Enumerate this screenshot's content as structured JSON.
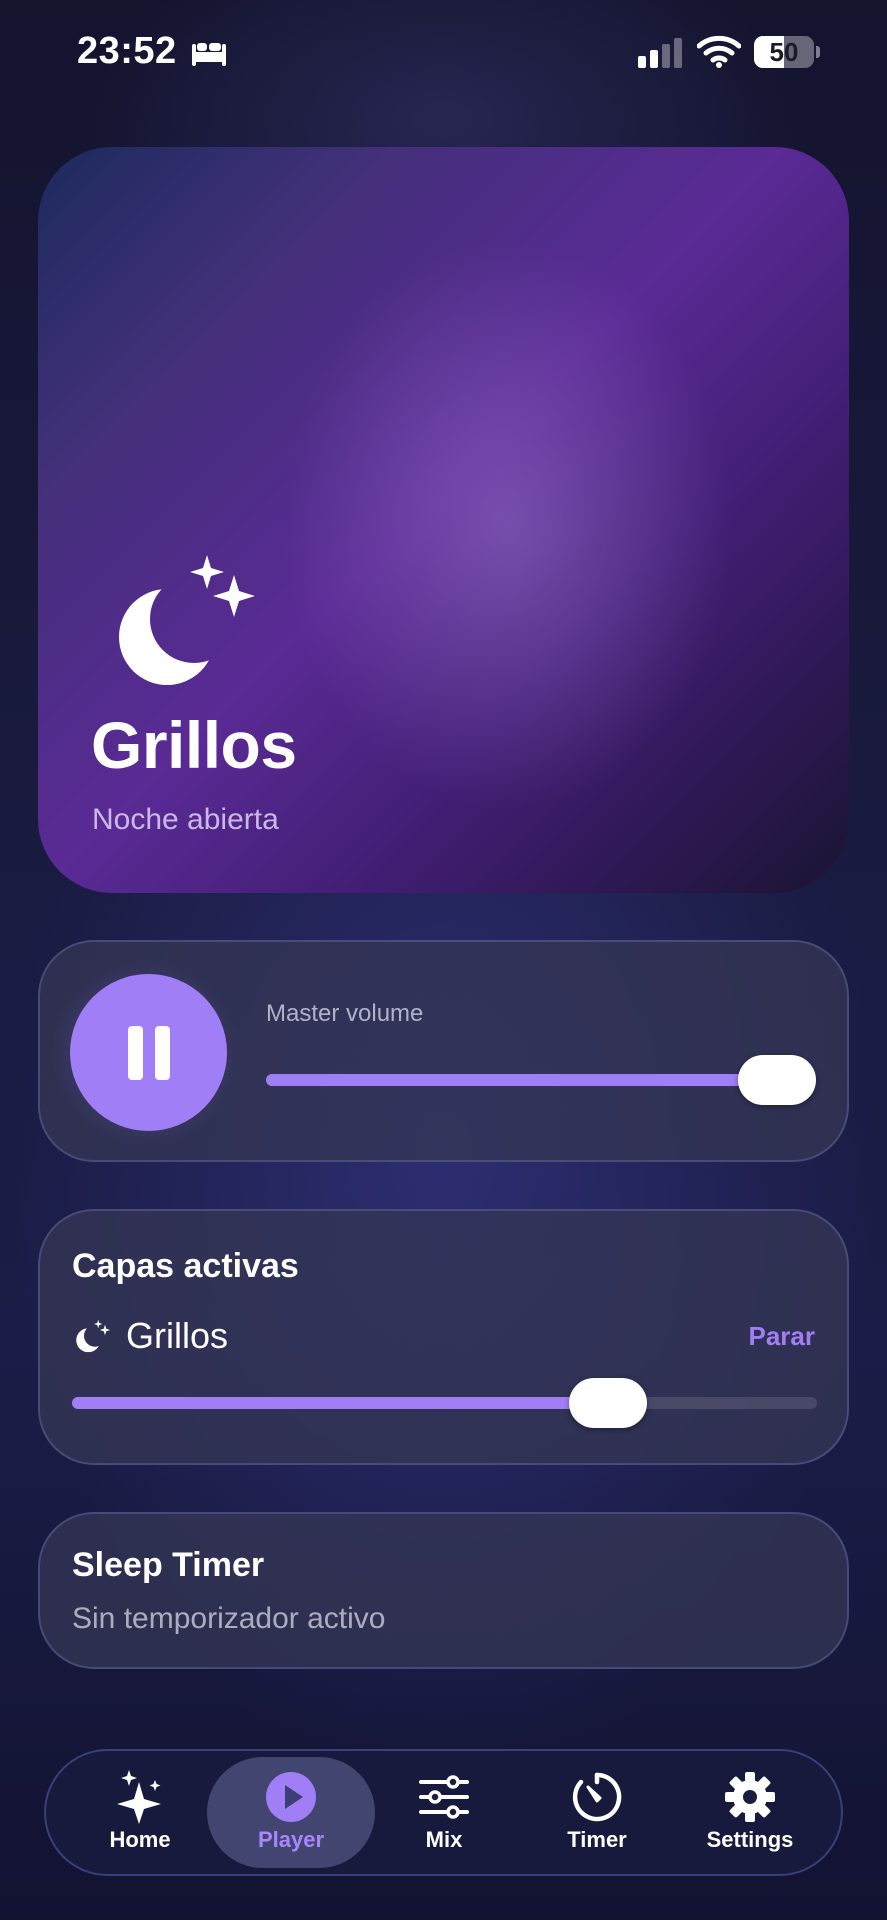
{
  "status_bar": {
    "time": "23:52",
    "battery": "50",
    "battery_level": 0.5,
    "icons": [
      "bed-icon",
      "signal-icon",
      "wifi-icon",
      "battery-icon"
    ]
  },
  "hero": {
    "icon": "moon-stars-icon",
    "title": "Grillos",
    "subtitle": "Noche abierta"
  },
  "player": {
    "pause_icon": "pause-icon",
    "volume_label": "Master volume",
    "volume_level": 0.93
  },
  "layers": {
    "title": "Capas activas",
    "items": [
      {
        "icon": "moon-stars-icon",
        "name": "Grillos",
        "action": "Parar",
        "level": 0.72
      }
    ]
  },
  "timer": {
    "title": "Sleep Timer",
    "status": "Sin temporizador activo"
  },
  "tab_bar": {
    "active": "Player",
    "tabs": [
      {
        "label": "Home",
        "icon": "sparkles-icon"
      },
      {
        "label": "Player",
        "icon": "play-circle-icon"
      },
      {
        "label": "Mix",
        "icon": "sliders-icon"
      },
      {
        "label": "Timer",
        "icon": "timer-icon"
      },
      {
        "label": "Settings",
        "icon": "gear-icon"
      }
    ]
  },
  "colors": {
    "accent": "#a07ef6",
    "accent_text": "#a986ff",
    "background": "#191a3e",
    "card": "#343654"
  }
}
